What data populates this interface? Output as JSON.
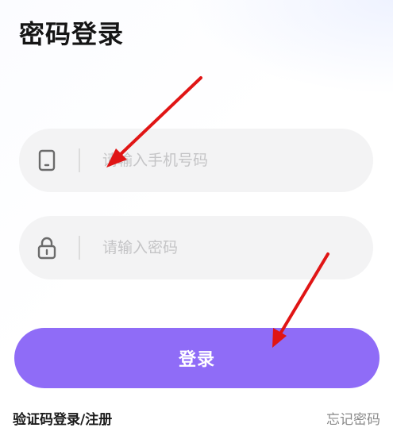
{
  "page": {
    "title": "密码登录"
  },
  "form": {
    "phone_placeholder": "请输入手机号码",
    "password_placeholder": "请输入密码",
    "login_label": "登录"
  },
  "footer": {
    "sms_login_register": "验证码登录/注册",
    "forgot_password": "忘记密码"
  },
  "icons": {
    "phone": "phone-icon",
    "lock": "lock-icon",
    "annotation_arrow": "red-arrow"
  },
  "colors": {
    "primary": "#8f6cf7",
    "field_bg": "#f3f3f4",
    "placeholder": "#c4c4c6",
    "annotation": "#e01515"
  }
}
